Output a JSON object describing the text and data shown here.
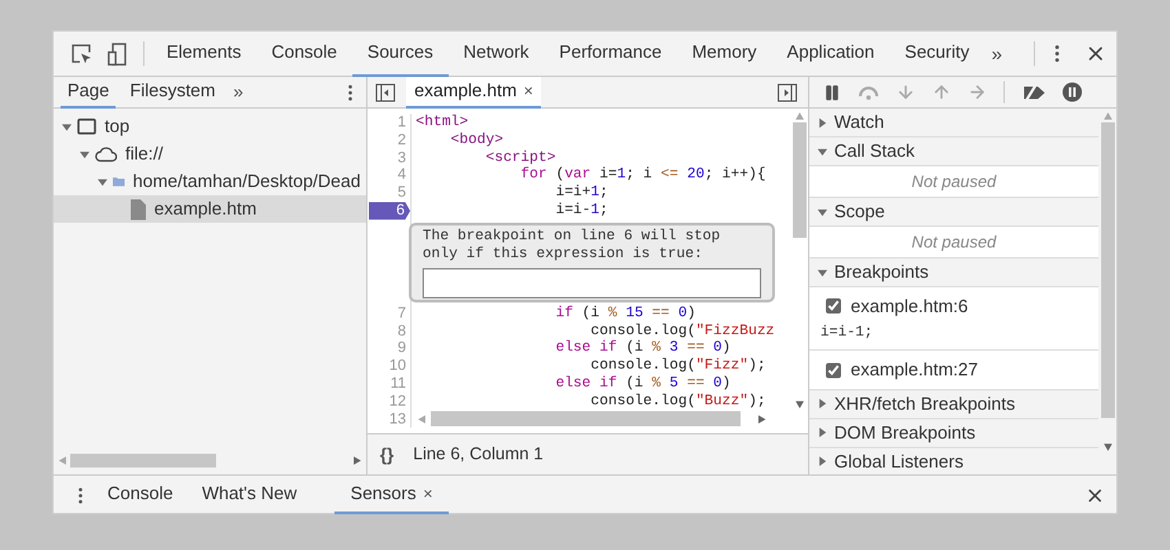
{
  "main_tabs": [
    {
      "label": "Elements",
      "selected": false
    },
    {
      "label": "Console",
      "selected": false
    },
    {
      "label": "Sources",
      "selected": true
    },
    {
      "label": "Network",
      "selected": false
    },
    {
      "label": "Performance",
      "selected": false
    },
    {
      "label": "Memory",
      "selected": false
    },
    {
      "label": "Application",
      "selected": false
    },
    {
      "label": "Security",
      "selected": false
    }
  ],
  "main_overflow": "»",
  "navigator": {
    "tabs": [
      {
        "label": "Page",
        "selected": true
      },
      {
        "label": "Filesystem",
        "selected": false
      }
    ],
    "overflow": "»",
    "tree": [
      {
        "label": "top",
        "kind": "frame",
        "expanded": true,
        "selected": false,
        "children": [
          {
            "label": "file://",
            "kind": "cloud",
            "expanded": true,
            "selected": false,
            "children": [
              {
                "label": "home/tamhan/Desktop/Dead",
                "kind": "folder",
                "expanded": true,
                "selected": false,
                "children": [
                  {
                    "label": "example.htm",
                    "kind": "file",
                    "selected": true
                  }
                ]
              }
            ]
          }
        ]
      }
    ]
  },
  "editor": {
    "tabs": [
      {
        "label": "example.htm",
        "close": "×",
        "selected": true
      }
    ],
    "lines": [
      {
        "number": "1",
        "breakpoint": false,
        "tokens": [
          {
            "kind": "tag",
            "text": "<html>"
          }
        ]
      },
      {
        "number": "2",
        "breakpoint": false,
        "tokens": [
          {
            "kind": "tag",
            "text": "    <body>"
          }
        ]
      },
      {
        "number": "3",
        "breakpoint": false,
        "tokens": [
          {
            "kind": "tag",
            "text": "        <script>"
          }
        ]
      },
      {
        "number": "4",
        "breakpoint": false,
        "tokens": [
          {
            "kind": "keyword",
            "text": "            for"
          },
          {
            "kind": "plain",
            "text": " ("
          },
          {
            "kind": "keyword",
            "text": "var"
          },
          {
            "kind": "plain",
            "text": " i="
          },
          {
            "kind": "number",
            "text": "1"
          },
          {
            "kind": "plain",
            "text": "; i "
          },
          {
            "kind": "operator",
            "text": "<= "
          },
          {
            "kind": "number",
            "text": "20"
          },
          {
            "kind": "plain",
            "text": "; i++){"
          }
        ]
      },
      {
        "number": "5",
        "breakpoint": false,
        "tokens": [
          {
            "kind": "plain",
            "text": "                i=i+"
          },
          {
            "kind": "number",
            "text": "1"
          },
          {
            "kind": "plain",
            "text": ";"
          }
        ]
      },
      {
        "number": "6",
        "breakpoint": true,
        "tokens": [
          {
            "kind": "plain",
            "text": "                i=i-"
          },
          {
            "kind": "number",
            "text": "1"
          },
          {
            "kind": "plain",
            "text": ";"
          }
        ],
        "condition_popup": {
          "message": "The breakpoint on line 6 will stop only if this expression is true:"
        }
      },
      {
        "number": "7",
        "breakpoint": false,
        "tokens": [
          {
            "kind": "keyword",
            "text": "                if"
          },
          {
            "kind": "plain",
            "text": " (i "
          },
          {
            "kind": "operator",
            "text": "% "
          },
          {
            "kind": "number",
            "text": "15"
          },
          {
            "kind": "operator",
            "text": " == "
          },
          {
            "kind": "number",
            "text": "0"
          },
          {
            "kind": "plain",
            "text": ")"
          }
        ]
      },
      {
        "number": "8",
        "breakpoint": false,
        "tokens": [
          {
            "kind": "plain",
            "text": "                    console.log("
          },
          {
            "kind": "string",
            "text": "\"FizzBuzz"
          }
        ]
      },
      {
        "number": "9",
        "breakpoint": false,
        "tokens": [
          {
            "kind": "keyword",
            "text": "                else if"
          },
          {
            "kind": "plain",
            "text": " (i "
          },
          {
            "kind": "operator",
            "text": "% "
          },
          {
            "kind": "number",
            "text": "3"
          },
          {
            "kind": "operator",
            "text": " == "
          },
          {
            "kind": "number",
            "text": "0"
          },
          {
            "kind": "plain",
            "text": ")"
          }
        ]
      },
      {
        "number": "10",
        "breakpoint": false,
        "tokens": [
          {
            "kind": "plain",
            "text": "                    console.log("
          },
          {
            "kind": "string",
            "text": "\"Fizz\""
          },
          {
            "kind": "plain",
            "text": ");"
          }
        ]
      },
      {
        "number": "11",
        "breakpoint": false,
        "tokens": [
          {
            "kind": "keyword",
            "text": "                else if"
          },
          {
            "kind": "plain",
            "text": " (i "
          },
          {
            "kind": "operator",
            "text": "% "
          },
          {
            "kind": "number",
            "text": "5"
          },
          {
            "kind": "operator",
            "text": " == "
          },
          {
            "kind": "number",
            "text": "0"
          },
          {
            "kind": "plain",
            "text": ")"
          }
        ]
      },
      {
        "number": "12",
        "breakpoint": false,
        "tokens": [
          {
            "kind": "plain",
            "text": "                    console.log("
          },
          {
            "kind": "string",
            "text": "\"Buzz\""
          },
          {
            "kind": "plain",
            "text": ");"
          }
        ]
      },
      {
        "number": "13",
        "breakpoint": false
      }
    ],
    "status": {
      "pretty_print": "{}",
      "position": "Line 6, Column 1"
    }
  },
  "debugger": {
    "sections": [
      {
        "title": "Watch",
        "expanded": false
      },
      {
        "title": "Call Stack",
        "expanded": true,
        "message": "Not paused"
      },
      {
        "title": "Scope",
        "expanded": true,
        "message": "Not paused"
      },
      {
        "title": "Breakpoints",
        "expanded": true,
        "breakpoints": [
          {
            "label": "example.htm:6",
            "checked": true,
            "code": "i=i-1;"
          },
          {
            "label": "example.htm:27",
            "checked": true
          }
        ]
      },
      {
        "title": "XHR/fetch Breakpoints",
        "expanded": false
      },
      {
        "title": "DOM Breakpoints",
        "expanded": false
      },
      {
        "title": "Global Listeners",
        "expanded": false
      }
    ]
  },
  "drawer": {
    "tabs": [
      {
        "label": "Console",
        "selected": false
      },
      {
        "label": "What's New",
        "selected": false
      },
      {
        "label": "Sensors",
        "selected": true,
        "close": "×"
      }
    ]
  }
}
